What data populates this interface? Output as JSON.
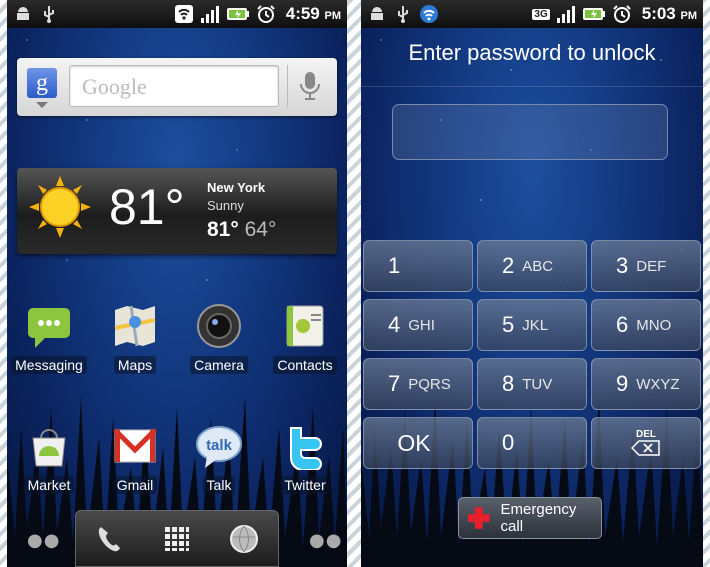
{
  "left_phone": {
    "status": {
      "time": "4:59",
      "ampm": "PM"
    },
    "search": {
      "logo": "g",
      "placeholder": "Google"
    },
    "weather": {
      "temp": "81°",
      "city": "New York",
      "condition": "Sunny",
      "high": "81°",
      "low": "64°"
    },
    "apps": [
      {
        "label": "Messaging",
        "icon": "messaging-icon"
      },
      {
        "label": "Maps",
        "icon": "maps-icon"
      },
      {
        "label": "Camera",
        "icon": "camera-icon"
      },
      {
        "label": "Contacts",
        "icon": "contacts-icon"
      },
      {
        "label": "Market",
        "icon": "market-icon"
      },
      {
        "label": "Gmail",
        "icon": "gmail-icon"
      },
      {
        "label": "Talk",
        "icon": "talk-icon",
        "icon_text": "talk"
      },
      {
        "label": "Twitter",
        "icon": "twitter-icon"
      }
    ],
    "dock": [
      "phone-icon",
      "app-drawer-icon",
      "browser-icon"
    ]
  },
  "right_phone": {
    "status": {
      "time": "5:03",
      "ampm": "PM",
      "network": "3G"
    },
    "title": "Enter password to unlock",
    "keys": [
      {
        "num": "1",
        "letters": ""
      },
      {
        "num": "2",
        "letters": "ABC"
      },
      {
        "num": "3",
        "letters": "DEF"
      },
      {
        "num": "4",
        "letters": "GHI"
      },
      {
        "num": "5",
        "letters": "JKL"
      },
      {
        "num": "6",
        "letters": "MNO"
      },
      {
        "num": "7",
        "letters": "PQRS"
      },
      {
        "num": "8",
        "letters": "TUV"
      },
      {
        "num": "9",
        "letters": "WXYZ"
      }
    ],
    "ok_label": "OK",
    "zero": "0",
    "del_label": "DEL",
    "emergency_label": "Emergency call"
  },
  "colors": {
    "accent_green": "#7ac43b",
    "emergency_red": "#e8202c"
  }
}
